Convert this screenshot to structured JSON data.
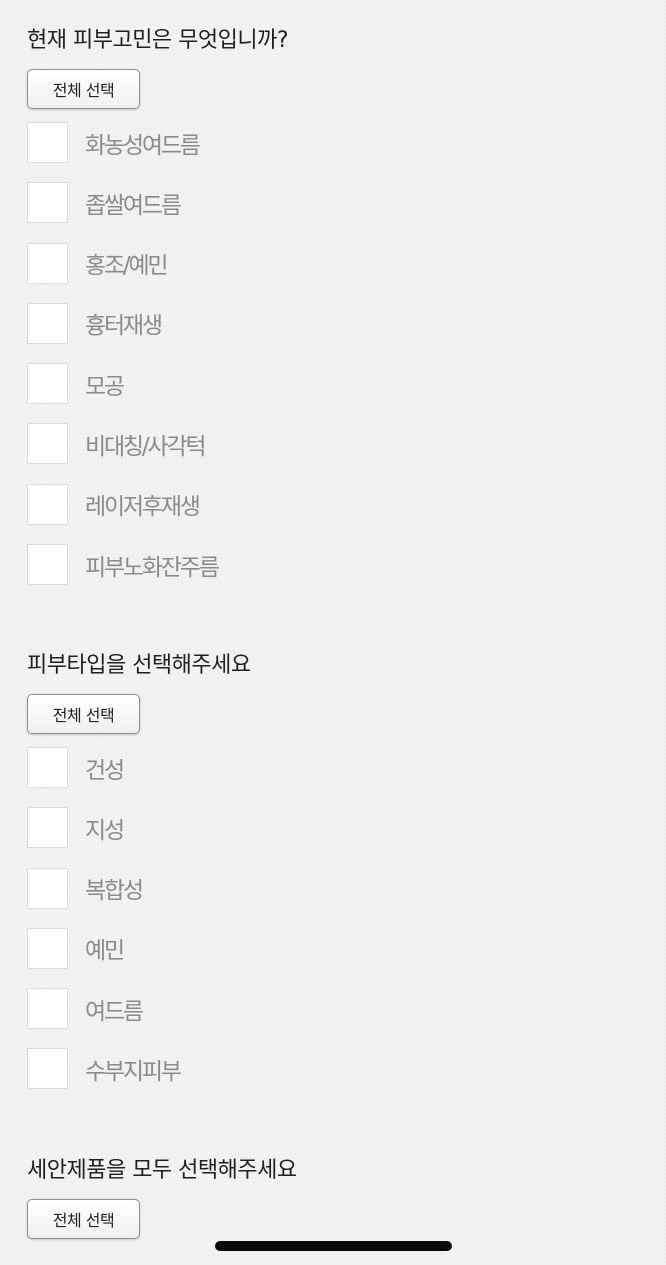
{
  "select_all_label": "전체 선택",
  "sections": [
    {
      "title": "현재 피부고민은 무엇입니까?",
      "options": [
        "화농성여드름",
        "좁쌀여드름",
        "홍조/예민",
        "흉터재생",
        "모공",
        "비대칭/사각턱",
        "레이저후재생",
        "피부노화잔주름"
      ]
    },
    {
      "title": "피부타입을 선택해주세요",
      "options": [
        "건성",
        "지성",
        "복합성",
        "예민",
        "여드름",
        "수부지피부"
      ]
    },
    {
      "title": "세안제품을 모두 선택해주세요",
      "options": []
    }
  ]
}
